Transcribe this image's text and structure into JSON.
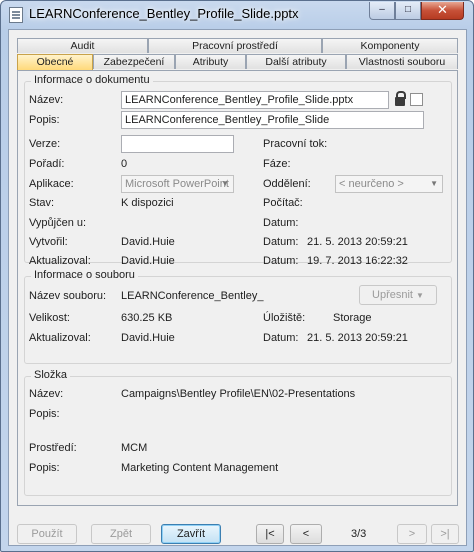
{
  "window": {
    "title": "LEARNConference_Bentley_Profile_Slide.pptx",
    "minimize_glyph": "–",
    "maximize_glyph": "□",
    "close_glyph": "✕"
  },
  "tabs": {
    "row1": [
      "Audit",
      "Pracovní prostředí",
      "Komponenty"
    ],
    "row2": [
      "Obecné",
      "Zabezpečení",
      "Atributy",
      "Další atributy",
      "Vlastnosti souboru"
    ],
    "active": "Obecné"
  },
  "doc_info": {
    "title": "Informace o dokumentu",
    "name_label": "Název:",
    "name_value": "LEARNConference_Bentley_Profile_Slide.pptx",
    "desc_label": "Popis:",
    "desc_value": "LEARNConference_Bentley_Profile_Slide",
    "version_label": "Verze:",
    "version_value": "",
    "workflow_label": "Pracovní tok:",
    "order_label": "Pořadí:",
    "order_value": "0",
    "phase_label": "Fáze:",
    "app_label": "Aplikace:",
    "app_value": "Microsoft PowerPoint",
    "dept_label": "Oddělení:",
    "dept_value": "< neurčeno >",
    "state_label": "Stav:",
    "state_value": "K dispozici",
    "computer_label": "Počítač:",
    "checkedout_label": "Vypůjčen u:",
    "date_label": "Datum:",
    "created_label": "Vytvořil:",
    "created_value": "David.Huie",
    "created_date": "21. 5. 2013 20:59:21",
    "updated_label": "Aktualizoval:",
    "updated_value": "David.Huie",
    "updated_date": "19. 7. 2013 16:22:32"
  },
  "file_info": {
    "title": "Informace o souboru",
    "filename_label": "Název souboru:",
    "filename_value": "LEARNConference_Bentley_",
    "refine_button": "Upřesnit",
    "size_label": "Velikost:",
    "size_value": "630.25 KB",
    "storage_label": "Úložiště:",
    "storage_value": "Storage",
    "updated_label": "Aktualizoval:",
    "updated_value": "David.Huie",
    "date_label": "Datum:",
    "date_value": "21. 5. 2013 20:59:21"
  },
  "folder": {
    "title": "Složka",
    "name_label": "Název:",
    "name_value": "Campaigns\\Bentley Profile\\EN\\02-Presentations",
    "desc_label": "Popis:",
    "desc_value": "",
    "env_label": "Prostředí:",
    "env_value": "MCM",
    "env_desc_label": "Popis:",
    "env_desc_value": "Marketing Content Management"
  },
  "footer": {
    "apply": "Použít",
    "back": "Zpět",
    "close": "Zavřít",
    "first": "|<",
    "prev": "<",
    "page": "3/3",
    "next": ">",
    "last": ">|"
  }
}
